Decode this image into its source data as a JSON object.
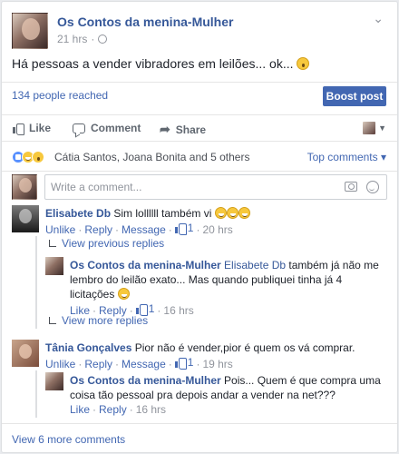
{
  "post": {
    "author": "Os Contos da menina-Mulher",
    "time": "21 hrs",
    "meta_separator": "·",
    "text": "Há pessoas a vender vibradores em leilões... ok...",
    "reach": "134 people reached",
    "boost_label": "Boost post"
  },
  "actions": {
    "like": "Like",
    "comment": "Comment",
    "share": "Share"
  },
  "reactions": {
    "names": "Cátia Santos, Joana Bonita and 5 others",
    "sort_label": "Top comments"
  },
  "composer": {
    "placeholder": "Write a comment..."
  },
  "labels": {
    "unlike": "Unlike",
    "like": "Like",
    "reply": "Reply",
    "message": "Message",
    "separator": "·"
  },
  "comments": [
    {
      "author": "Elisabete Db",
      "text": "Sim lollllll também vi",
      "likes": "1",
      "time": "20 hrs",
      "view_previous": "View previous replies",
      "view_more": "View more replies",
      "replies": [
        {
          "author": "Os Contos da menina-Mulher",
          "mention": "Elisabete Db",
          "text": "também já não me lembro do leilão exato... Mas quando publiquei tinha já 4 licitações",
          "likes": "1",
          "time": "16 hrs"
        }
      ]
    },
    {
      "author": "Tânia Gonçalves",
      "text": "Pior não é vender,pior é quem os vá comprar.",
      "likes": "1",
      "time": "19 hrs",
      "replies": [
        {
          "author": "Os Contos da menina-Mulher",
          "text": "Pois... Quem é que compra uma coisa tão pessoal pra depois andar a vender na net???",
          "time": "16 hrs"
        }
      ]
    }
  ],
  "view_more_comments": "View 6 more comments",
  "icons": {
    "menu": "chevron-down-icon",
    "privacy": "globe-icon",
    "emoji_wow": "astonished-emoji-icon",
    "emoji_grin": "grinning-emoji-icon",
    "camera": "camera-icon",
    "smile": "smiley-icon"
  },
  "colors": {
    "link": "#4267b2",
    "name": "#365899",
    "meta": "#90949c",
    "boost_bg": "#4267b2"
  }
}
